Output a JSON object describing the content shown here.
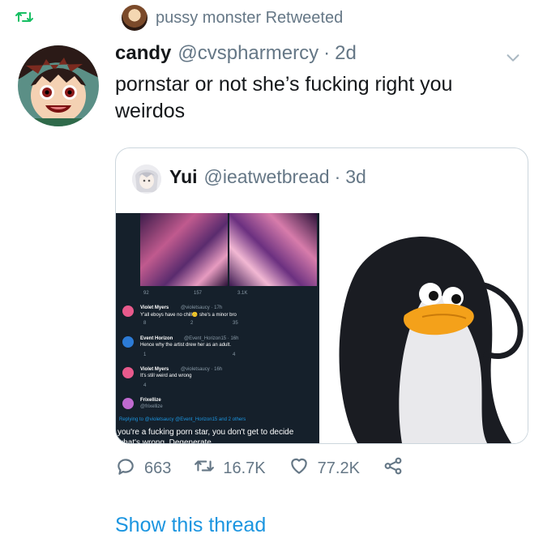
{
  "retweet": {
    "icon": "retweet-icon",
    "text": "pussy monster Retweeted"
  },
  "tweet": {
    "name": "candy",
    "handle": "@cvspharmercy",
    "separator": "·",
    "time": "2d",
    "text": "pornstar or not she’s fucking right you weirdos",
    "menu_icon": "chevron-down-icon"
  },
  "quoted": {
    "name": "Yui",
    "handle": "@ieatwetbread",
    "separator": "·",
    "time": "3d",
    "screenshot": {
      "top_counts": {
        "replies": "92",
        "retweets": "157",
        "likes": "3.1K"
      },
      "replies": [
        {
          "name": "Violet Myers",
          "meta": "@violetsaucy · 17h",
          "text": "Y'all eboys have no chill🙃 she's a minor bro",
          "counts": {
            "replies": "8",
            "retweets": "2",
            "likes": "35"
          }
        },
        {
          "name": "Event Horizon",
          "meta": "@Event_Horizon15 · 16h",
          "text": "Hence why the artist drew her as an adult.",
          "counts": {
            "replies": "1",
            "retweets": "",
            "likes": "4"
          }
        },
        {
          "name": "Violet Myers",
          "meta": "@violetsaucy · 16h",
          "text": "It's still weird and wrong",
          "counts": {
            "replies": "4",
            "retweets": "",
            "likes": ""
          }
        },
        {
          "name": "Frixellize",
          "meta": "@frixellize",
          "text": "",
          "counts": {
            "replies": "",
            "retweets": "",
            "likes": ""
          }
        }
      ],
      "replying_to": "Replying to @violetsaucy @Event_Horizon15 and 2 others",
      "final_reply": "you're a fucking porn star, you don't get to decide what's wrong. Degenerate"
    }
  },
  "actions": {
    "replies": "663",
    "retweets": "16.7K",
    "likes": "77.2K"
  },
  "show_thread": "Show this thread",
  "colors": {
    "accent": "#1b95e0",
    "retweet_green": "#17bf63",
    "muted": "#657786",
    "border": "#ccd6dd"
  }
}
